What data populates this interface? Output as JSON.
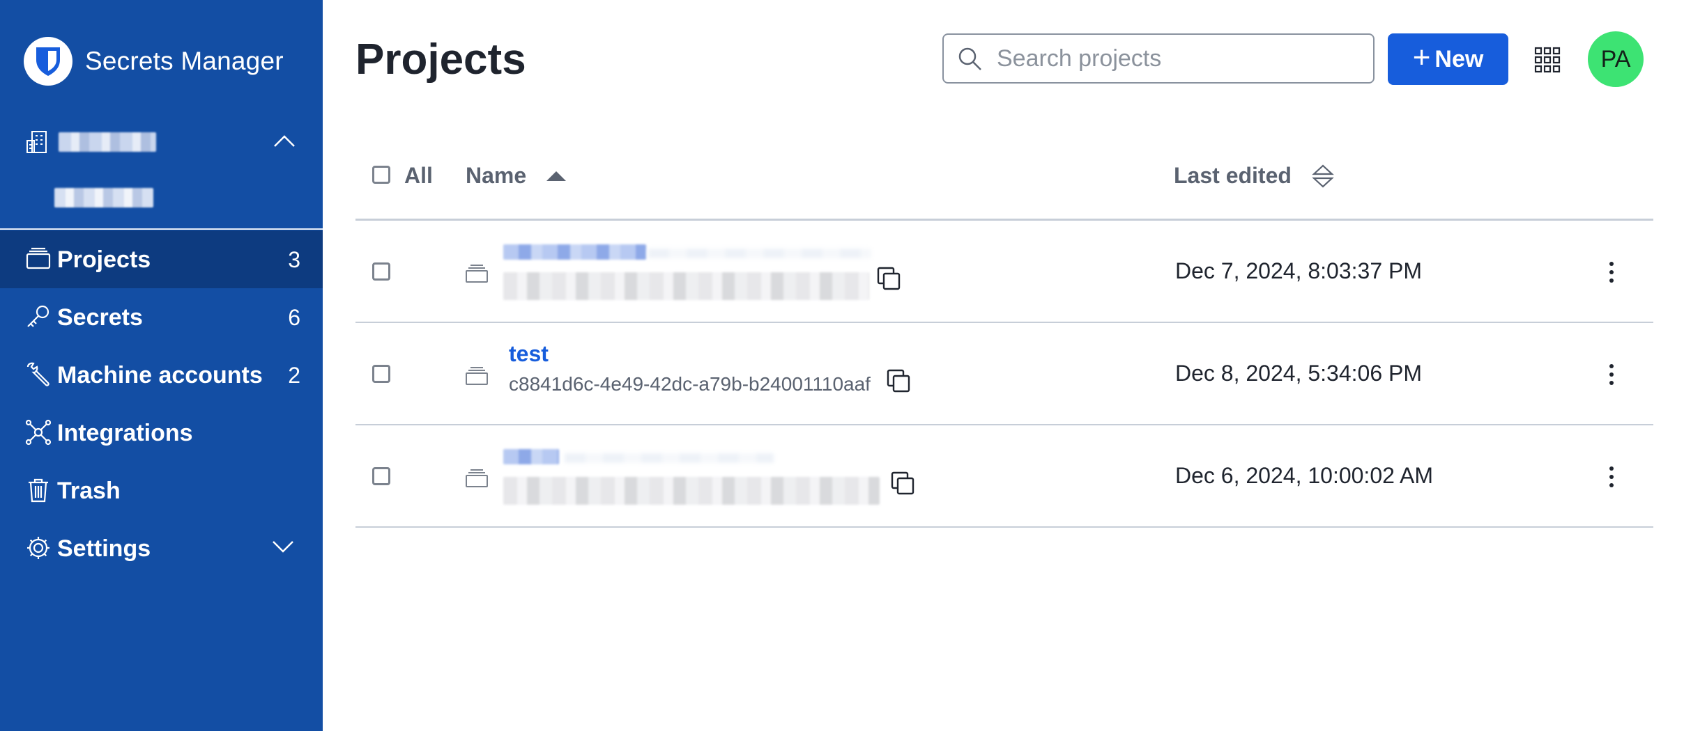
{
  "sidebar": {
    "app_name": "Secrets Manager",
    "nav": [
      {
        "label": "Projects",
        "count": "3",
        "icon": "projects-icon",
        "active": true
      },
      {
        "label": "Secrets",
        "count": "6",
        "icon": "key-icon"
      },
      {
        "label": "Machine accounts",
        "count": "2",
        "icon": "wrench-icon"
      },
      {
        "label": "Integrations",
        "count": "",
        "icon": "integrations-icon"
      },
      {
        "label": "Trash",
        "count": "",
        "icon": "trash-icon"
      },
      {
        "label": "Settings",
        "count": "",
        "icon": "gear-icon"
      }
    ]
  },
  "header": {
    "title": "Projects",
    "search_placeholder": "Search projects",
    "new_label": "New",
    "avatar_initials": "PA"
  },
  "table": {
    "col_all": "All",
    "col_name": "Name",
    "col_last_edited": "Last edited",
    "rows": [
      {
        "name": "",
        "id": "",
        "edited": "Dec 7, 2024, 8:03:37 PM"
      },
      {
        "name": "test",
        "id": "c8841d6c-4e49-42dc-a79b-b24001110aaf",
        "edited": "Dec 8, 2024, 5:34:06 PM"
      },
      {
        "name": "",
        "id": "",
        "edited": "Dec 6, 2024, 10:00:02 AM"
      }
    ]
  },
  "colors": {
    "sidebar_bg": "#134ea4",
    "sidebar_active": "#0d3b80",
    "primary": "#175ddc",
    "avatar_bg": "#3de373"
  }
}
